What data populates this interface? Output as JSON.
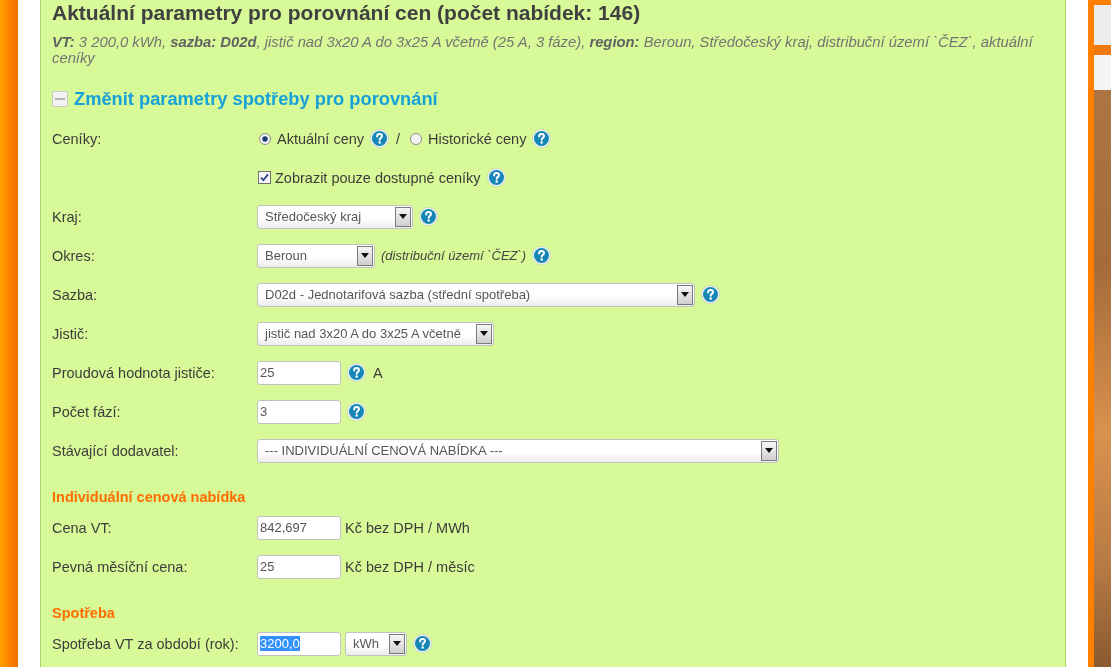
{
  "page": {
    "title": "Aktuální parametry pro porovnání cen (počet nabídek: 146)",
    "summary": "**VT:** 3 200,0 kWh, **sazba: D02d**, jistič nad 3x20 A do 3x25 A včetně (25 A, 3 fáze), **region:** Beroun, Středočeský kraj, distribuční území `ČEZ`, aktuální ceníky"
  },
  "parameters_section": {
    "title": "Změnit parametry spotřeby pro porovnání",
    "expanded": true
  },
  "form_rows": [
    {
      "kind": "radios",
      "label": "Ceníky:",
      "separator": "/",
      "options": [
        {
          "label": "Aktuální ceny",
          "selected": true,
          "help": true
        },
        {
          "label": "Historické ceny",
          "selected": false,
          "help": true
        }
      ]
    },
    {
      "kind": "checkbox",
      "text": "Zobrazit pouze dostupné ceníky",
      "checked": true,
      "help": true
    },
    {
      "kind": "select",
      "label": "Kraj:",
      "value": "Středočeský kraj",
      "help": true
    },
    {
      "kind": "select",
      "label": "Okres:",
      "value": "Beroun",
      "note": "(distribuční území `ČEZ`)",
      "help": true
    },
    {
      "kind": "select",
      "label": "Sazba:",
      "value": "D02d - Jednotarifová sazba (střední spotřeba)",
      "help": true
    },
    {
      "kind": "select",
      "label": "Jistič:",
      "value": "jistič nad 3x20 A do 3x25 A včetně",
      "help": false
    },
    {
      "kind": "input",
      "label": "Proudová hodnota jističe:",
      "value": "25",
      "help": true,
      "unit": "A"
    },
    {
      "kind": "input",
      "label": "Počet fází:",
      "value": "3",
      "help": true
    },
    {
      "kind": "select",
      "label": "Stávající dodavatel:",
      "value": "--- INDIVIDUÁLNÍ CENOVÁ NABÍDKA ---",
      "help": false
    },
    {
      "kind": "heading",
      "text": "Individuální cenová nabídka"
    },
    {
      "kind": "input",
      "label": "Cena VT:",
      "value": "842,697",
      "help": false,
      "unit": "Kč bez DPH / MWh"
    },
    {
      "kind": "input",
      "label": "Pevná měsíční cena:",
      "value": "25",
      "help": false,
      "unit": "Kč bez DPH / měsíc"
    },
    {
      "kind": "heading",
      "text": "Spotřeba"
    },
    {
      "kind": "input_unit_select",
      "label": "Spotřeba VT za období (rok):",
      "value": "3200,0",
      "text_selected": true,
      "unit_select": "kWh",
      "help": true
    }
  ]
}
